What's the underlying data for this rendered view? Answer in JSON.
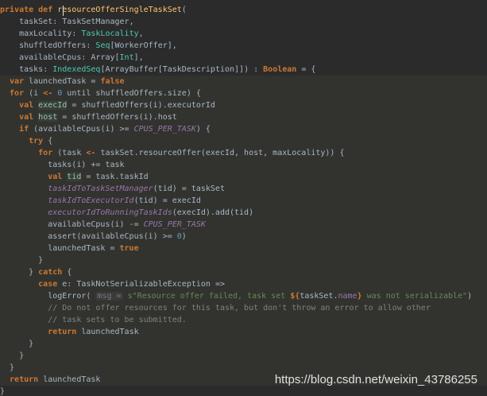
{
  "editor": {
    "lines": [
      {
        "scope": false,
        "tokens": [
          {
            "c": "kw",
            "t": "private def "
          },
          {
            "c": "fn",
            "t": "resourceOfferSingleTaskSet"
          },
          {
            "c": "plain",
            "t": "("
          }
        ]
      },
      {
        "scope": false,
        "tokens": [
          {
            "c": "param",
            "t": "    taskSet"
          },
          {
            "c": "plain",
            "t": ": TaskSetManager,"
          }
        ]
      },
      {
        "scope": false,
        "tokens": [
          {
            "c": "param",
            "t": "    maxLocality"
          },
          {
            "c": "plain",
            "t": ": "
          },
          {
            "c": "gtype",
            "t": "TaskLocality"
          },
          {
            "c": "plain",
            "t": ","
          }
        ]
      },
      {
        "scope": false,
        "tokens": [
          {
            "c": "param",
            "t": "    shuffledOffers"
          },
          {
            "c": "plain",
            "t": ": "
          },
          {
            "c": "gtype",
            "t": "Seq"
          },
          {
            "c": "plain",
            "t": "[WorkerOffer],"
          }
        ]
      },
      {
        "scope": false,
        "tokens": [
          {
            "c": "param",
            "t": "    availableCpus"
          },
          {
            "c": "plain",
            "t": ": Array["
          },
          {
            "c": "gtype",
            "t": "Int"
          },
          {
            "c": "plain",
            "t": "],"
          }
        ]
      },
      {
        "scope": false,
        "tokens": [
          {
            "c": "param",
            "t": "    tasks"
          },
          {
            "c": "plain",
            "t": ": "
          },
          {
            "c": "gtype",
            "t": "IndexedSeq"
          },
          {
            "c": "plain",
            "t": "[ArrayBuffer[TaskDescription]]) : "
          },
          {
            "c": "kw",
            "t": "Boolean"
          },
          {
            "c": "plain",
            "t": " = {"
          }
        ]
      },
      {
        "scope": true,
        "tokens": [
          {
            "c": "kw",
            "t": "  var "
          },
          {
            "c": "plain",
            "t": "launchedTask = "
          },
          {
            "c": "kw",
            "t": "false"
          }
        ]
      },
      {
        "scope": true,
        "tokens": [
          {
            "c": "kw",
            "t": "  for "
          },
          {
            "c": "plain",
            "t": "(i "
          },
          {
            "c": "kw",
            "t": "<- "
          },
          {
            "c": "num",
            "t": "0"
          },
          {
            "c": "plain",
            "t": " until shuffledOffers.size) {"
          }
        ]
      },
      {
        "scope": true,
        "tokens": [
          {
            "c": "kw",
            "t": "    val "
          },
          {
            "c": "hlv",
            "t": "execId"
          },
          {
            "c": "plain",
            "t": " = shuffledOffers(i).executorId"
          }
        ]
      },
      {
        "scope": true,
        "tokens": [
          {
            "c": "kw",
            "t": "    val "
          },
          {
            "c": "hlv",
            "t": "host"
          },
          {
            "c": "plain",
            "t": " = shuffledOffers(i).host"
          }
        ]
      },
      {
        "scope": true,
        "tokens": [
          {
            "c": "kw",
            "t": "    if "
          },
          {
            "c": "plain",
            "t": "(availableCpus(i) >= "
          },
          {
            "c": "const",
            "t": "CPUS_PER_TASK"
          },
          {
            "c": "plain",
            "t": ") {"
          }
        ]
      },
      {
        "scope": true,
        "tokens": [
          {
            "c": "kw",
            "t": "      try "
          },
          {
            "c": "plain",
            "t": "{"
          }
        ]
      },
      {
        "scope": true,
        "tokens": [
          {
            "c": "kw",
            "t": "        for "
          },
          {
            "c": "plain",
            "t": "(task "
          },
          {
            "c": "kw",
            "t": "<- "
          },
          {
            "c": "plain",
            "t": "taskSet.resourceOffer(execId, host, maxLocality)) {"
          }
        ]
      },
      {
        "scope": true,
        "tokens": [
          {
            "c": "plain",
            "t": "          tasks(i) += task"
          }
        ]
      },
      {
        "scope": true,
        "tokens": [
          {
            "c": "kw",
            "t": "          val "
          },
          {
            "c": "hlv",
            "t": "tid"
          },
          {
            "c": "plain",
            "t": " = task.taskId"
          }
        ]
      },
      {
        "scope": true,
        "tokens": [
          {
            "c": "ital",
            "t": "          taskIdToTaskSetManager"
          },
          {
            "c": "plain",
            "t": "(tid) = taskSet"
          }
        ]
      },
      {
        "scope": true,
        "tokens": [
          {
            "c": "ital",
            "t": "          taskIdToExecutorId"
          },
          {
            "c": "plain",
            "t": "(tid) = execId"
          }
        ]
      },
      {
        "scope": true,
        "tokens": [
          {
            "c": "ital",
            "t": "          executorIdToRunningTaskIds"
          },
          {
            "c": "plain",
            "t": "(execId).add(tid)"
          }
        ]
      },
      {
        "scope": true,
        "tokens": [
          {
            "c": "plain",
            "t": "          availableCpus(i) -= "
          },
          {
            "c": "const",
            "t": "CPUS_PER_TASK"
          }
        ]
      },
      {
        "scope": true,
        "tokens": [
          {
            "c": "plain",
            "t": "          assert(availableCpus(i) >= "
          },
          {
            "c": "num",
            "t": "0"
          },
          {
            "c": "plain",
            "t": ")"
          }
        ]
      },
      {
        "scope": true,
        "tokens": [
          {
            "c": "plain",
            "t": "          launchedTask = "
          },
          {
            "c": "kw",
            "t": "true"
          }
        ]
      },
      {
        "scope": true,
        "tokens": [
          {
            "c": "plain",
            "t": "        }"
          }
        ]
      },
      {
        "scope": true,
        "tokens": [
          {
            "c": "plain",
            "t": "      } "
          },
          {
            "c": "kw",
            "t": "catch "
          },
          {
            "c": "plain",
            "t": "{"
          }
        ]
      },
      {
        "scope": true,
        "tokens": [
          {
            "c": "kw",
            "t": "        case "
          },
          {
            "c": "plain",
            "t": "e: TaskNotSerializableException =>"
          }
        ]
      },
      {
        "scope": true,
        "tokens": [
          {
            "c": "plain",
            "t": "          logError( "
          },
          {
            "c": "hint",
            "t": "msg ="
          },
          {
            "c": "plain",
            "t": " "
          },
          {
            "c": "str",
            "t": "s\"Resource offer failed, task set "
          },
          {
            "c": "interp",
            "t": "${"
          },
          {
            "c": "plain",
            "t": "taskSet."
          },
          {
            "c": "field",
            "t": "name"
          },
          {
            "c": "interp",
            "t": "}"
          },
          {
            "c": "str",
            "t": " was not serializable\""
          },
          {
            "c": "plain",
            "t": ")"
          }
        ]
      },
      {
        "scope": true,
        "tokens": [
          {
            "c": "cmt",
            "t": "          // Do not offer resources for this task, but don't throw an error to allow other"
          }
        ]
      },
      {
        "scope": true,
        "tokens": [
          {
            "c": "cmt",
            "t": "          // task sets to be submitted."
          }
        ]
      },
      {
        "scope": true,
        "tokens": [
          {
            "c": "kw",
            "t": "          return "
          },
          {
            "c": "plain",
            "t": "launchedTask"
          }
        ]
      },
      {
        "scope": true,
        "tokens": [
          {
            "c": "plain",
            "t": "      }"
          }
        ]
      },
      {
        "scope": true,
        "tokens": [
          {
            "c": "plain",
            "t": "    }"
          }
        ]
      },
      {
        "scope": true,
        "tokens": [
          {
            "c": "plain",
            "t": "  }"
          }
        ]
      },
      {
        "scope": true,
        "tokens": [
          {
            "c": "kw",
            "t": "  return "
          },
          {
            "c": "plain",
            "t": "launchedTask"
          }
        ]
      },
      {
        "scope": false,
        "tokens": [
          {
            "c": "plain",
            "t": "}"
          }
        ]
      }
    ]
  },
  "watermark": "https://blog.csdn.net/weixin_43786255"
}
